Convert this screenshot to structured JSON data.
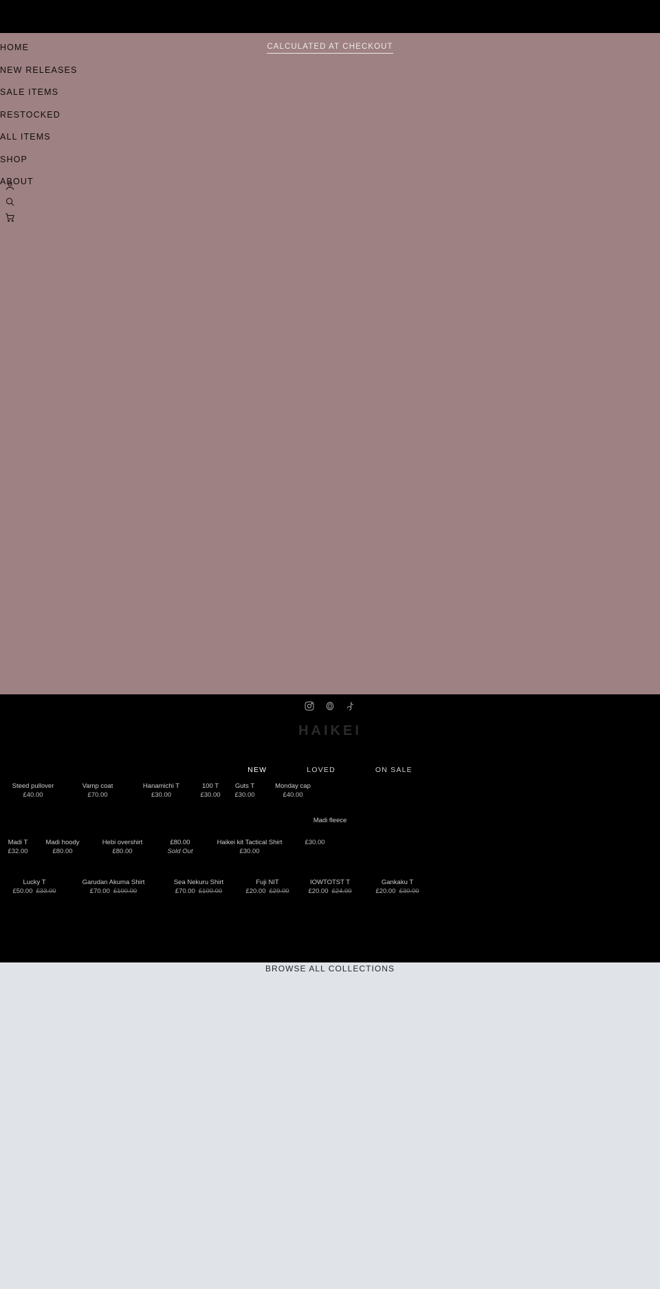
{
  "topbar": {
    "label": ""
  },
  "menu": {
    "items": [
      {
        "label": "HOME"
      },
      {
        "label": "NEW RELEASES"
      },
      {
        "label": "SALE ITEMS"
      },
      {
        "label": "RESTOCKED"
      },
      {
        "label": "ALL ITEMS"
      },
      {
        "label": "SHOP"
      },
      {
        "label": "ABOUT"
      }
    ],
    "icons": [
      {
        "name": "account-icon"
      },
      {
        "name": "search-icon"
      },
      {
        "name": "cart-icon"
      }
    ],
    "shipping_note": "CALCULATED AT CHECKOUT",
    "background_color": "#9e8182"
  },
  "footer": {
    "social": [
      {
        "name": "instagram-icon"
      },
      {
        "name": "discord-icon"
      },
      {
        "name": "tiktok-icon"
      }
    ],
    "brand": "HAIKEI",
    "tabs": [
      {
        "label": "NEW",
        "active": true
      },
      {
        "label": "LOVED",
        "active": false
      },
      {
        "label": "ON SALE",
        "active": false
      }
    ],
    "background_color": "#000000"
  },
  "products": {
    "row1": [
      {
        "title": "Steed pullover",
        "price": "£40.00",
        "was": "",
        "sold_out": ""
      },
      {
        "title": "Vamp coat",
        "price": "£70.00",
        "was": "",
        "sold_out": ""
      },
      {
        "title": "Hanamichi T",
        "price": "£30.00",
        "was": "",
        "sold_out": ""
      },
      {
        "title": "100 T",
        "price": "£30.00",
        "was": "",
        "sold_out": ""
      },
      {
        "title": "Guts T",
        "price": "£30.00",
        "was": "",
        "sold_out": ""
      },
      {
        "title": "Monday cap",
        "price": "£40.00",
        "was": "",
        "sold_out": ""
      }
    ],
    "row2_header": "Madi fleece",
    "row2": [
      {
        "title": "Madi T",
        "price": "£32.00",
        "was": "",
        "sold_out": ""
      },
      {
        "title": "Madi hoody",
        "price": "£80.00",
        "was": "",
        "sold_out": ""
      },
      {
        "title": "Hebi overshirt",
        "price": "£80.00",
        "was": "",
        "sold_out": ""
      },
      {
        "title": "",
        "price": "£80.00",
        "was": "",
        "sold_out": "Sold Out"
      },
      {
        "title": "Haikei kit Tactical Shirt",
        "price": "£30.00",
        "was": "",
        "sold_out": ""
      },
      {
        "title": "",
        "price": "£30.00",
        "was": "",
        "sold_out": ""
      }
    ],
    "row3": [
      {
        "title": "Lucky T",
        "price": "£50.00",
        "was": "£33.00",
        "sold_out": ""
      },
      {
        "title": "Garudan Akuma Shirt",
        "price": "£70.00",
        "was": "£100.00",
        "sold_out": ""
      },
      {
        "title": "Sea Nekuru Shirt",
        "price": "£70.00",
        "was": "£100.00",
        "sold_out": ""
      },
      {
        "title": "Fuji NIT",
        "price": "£20.00",
        "was": "£29.00",
        "sold_out": ""
      },
      {
        "title": "IOWTOTST T",
        "price": "£20.00",
        "was": "£24.00",
        "sold_out": ""
      },
      {
        "title": "Gankaku T",
        "price": "£20.00",
        "was": "£30.00",
        "sold_out": ""
      }
    ]
  },
  "bottom": {
    "browse_label": "BROWSE ALL COLLECTIONS",
    "background_color": "#e0e3e8"
  }
}
